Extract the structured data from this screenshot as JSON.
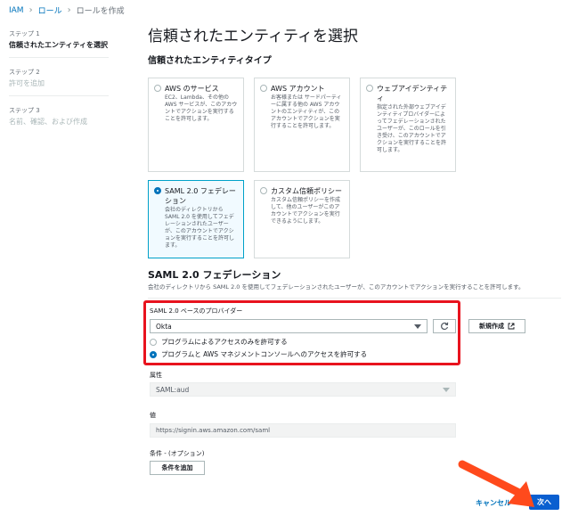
{
  "breadcrumb": {
    "items": [
      "IAM",
      "ロール",
      "ロールを作成"
    ]
  },
  "steps": [
    {
      "num": "ステップ 1",
      "title": "信頼されたエンティティを選択"
    },
    {
      "num": "ステップ 2",
      "title": "許可を追加"
    },
    {
      "num": "ステップ 3",
      "title": "名前、確認、および作成"
    }
  ],
  "page_title": "信頼されたエンティティを選択",
  "entity_section_title": "信頼されたエンティティタイプ",
  "entity_types": [
    {
      "title": "AWS のサービス",
      "desc": "EC2、Lambda、その他の AWS サービスが、このアカウントでアクションを実行することを許可します。",
      "selected": false
    },
    {
      "title": "AWS アカウント",
      "desc": "お客様または サードパーティーに属する他の AWS アカウントのエンティティが、このアカウントでアクションを実行することを許可します。",
      "selected": false
    },
    {
      "title": "ウェブアイデンティティ",
      "desc": "指定された外部ウェブアイデンティティプロバイダーによってフェデレーションされたユーザーが、このロールを引き受け、このアカウントでアクションを実行することを許可します。",
      "selected": false
    },
    {
      "title": "SAML 2.0 フェデレーション",
      "desc": "会社のディレクトリから SAML 2.0 を使用してフェデレーションされたユーザーが、このアカウントでアクションを実行することを許可します。",
      "selected": true
    },
    {
      "title": "カスタム信頼ポリシー",
      "desc": "カスタム信頼ポリシーを作成して、他のユーザーがこのアカウントでアクションを実行できるようにします。",
      "selected": false
    }
  ],
  "saml": {
    "title": "SAML 2.0 フェデレーション",
    "desc": "会社のディレクトリから SAML 2.0 を使用してフェデレーションされたユーザーが、このアカウントでアクションを実行することを許可します。",
    "provider_label": "SAML 2.0 ベースのプロバイダー",
    "provider_value": "Okta",
    "create_new_label": "新規作成",
    "access_options": [
      {
        "label": "プログラムによるアクセスのみを許可する",
        "selected": false
      },
      {
        "label": "プログラムと AWS マネジメントコンソールへのアクセスを許可する",
        "selected": true
      }
    ],
    "attribute_label": "属性",
    "attribute_value": "SAML:aud",
    "value_label": "値",
    "value_value": "https://signin.aws.amazon.com/saml",
    "condition_label": "条件 - (オプション)",
    "add_condition_label": "条件を追加"
  },
  "footer": {
    "cancel_label": "キャンセル",
    "next_label": "次へ"
  },
  "colors": {
    "accent": "#0073bb",
    "highlight": "#e8131e",
    "arrow": "#ff4a1c",
    "primary_button": "#0a5fd0"
  },
  "icons": {
    "refresh": "refresh-icon",
    "external": "external-link-icon"
  }
}
